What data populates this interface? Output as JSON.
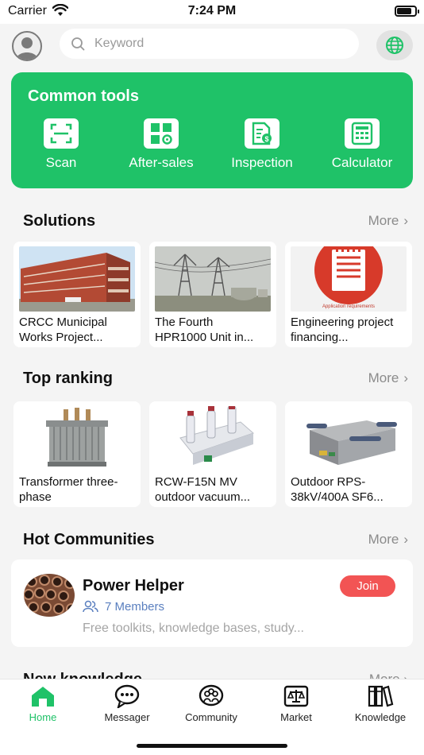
{
  "status_bar": {
    "carrier": "Carrier",
    "time": "7:24 PM"
  },
  "search": {
    "placeholder": "Keyword"
  },
  "icons": {
    "avatar": "user-avatar-icon",
    "search": "search-icon",
    "language": "globe-icon"
  },
  "common_tools": {
    "title": "Common tools",
    "items": [
      {
        "label": "Scan",
        "icon": "scan-icon"
      },
      {
        "label": "After-sales",
        "icon": "after-sales-icon"
      },
      {
        "label": "Inspection",
        "icon": "inspection-icon"
      },
      {
        "label": "Calculator",
        "icon": "calculator-icon"
      }
    ]
  },
  "solutions": {
    "title": "Solutions",
    "more": "More",
    "items": [
      {
        "line1": "CRCC Municipal",
        "line2": "Works Project..."
      },
      {
        "line1": "The Fourth",
        "line2": "HPR1000 Unit in..."
      },
      {
        "line1": "Engineering project",
        "line2": "financing...",
        "image_caption": "Application requirements"
      }
    ]
  },
  "top_ranking": {
    "title": "Top ranking",
    "more": "More",
    "items": [
      {
        "line1": "Transformer three-",
        "line2": "phase"
      },
      {
        "line1": "RCW-F15N MV",
        "line2": "outdoor vacuum..."
      },
      {
        "line1": "Outdoor RPS-",
        "line2": "38kV/400A SF6..."
      }
    ]
  },
  "hot_communities": {
    "title": "Hot Communities",
    "more": "More",
    "item": {
      "name": "Power Helper",
      "members": "7 Members",
      "description": "Free toolkits, knowledge bases, study...",
      "join_label": "Join"
    }
  },
  "next_section": {
    "title": "New knowledge",
    "more": "More"
  },
  "tabbar": {
    "items": [
      {
        "label": "Home",
        "icon": "home-icon",
        "active": true
      },
      {
        "label": "Messager",
        "icon": "message-icon"
      },
      {
        "label": "Community",
        "icon": "community-icon"
      },
      {
        "label": "Market",
        "icon": "market-icon"
      },
      {
        "label": "Knowledge",
        "icon": "knowledge-icon"
      }
    ]
  },
  "colors": {
    "accent": "#1fc268",
    "join": "#f25454",
    "members": "#5a7fbf"
  }
}
